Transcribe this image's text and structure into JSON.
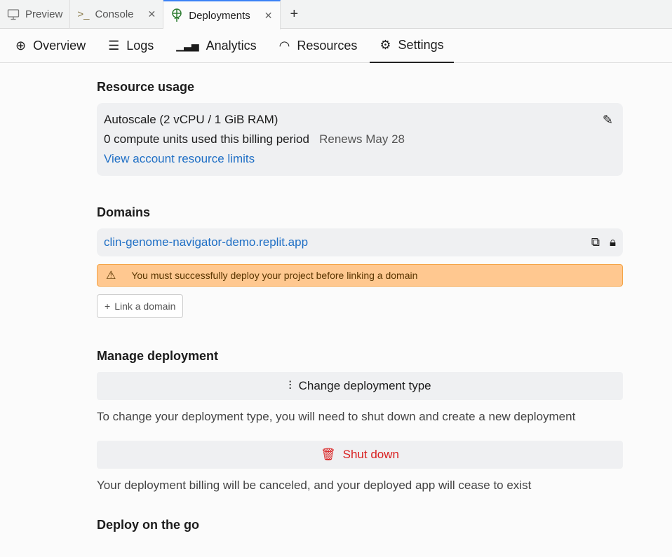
{
  "tabs": [
    {
      "label": "Preview",
      "icon": "monitor-icon"
    },
    {
      "label": "Console",
      "icon": "terminal-icon",
      "closable": true
    },
    {
      "label": "Deployments",
      "icon": "deploy-icon",
      "closable": true,
      "active": true
    }
  ],
  "new_tab": "+",
  "subnav": [
    {
      "label": "Overview"
    },
    {
      "label": "Logs"
    },
    {
      "label": "Analytics"
    },
    {
      "label": "Resources"
    },
    {
      "label": "Settings",
      "active": true
    }
  ],
  "resource": {
    "title": "Resource usage",
    "plan": "Autoscale (2 vCPU / 1 GiB RAM)",
    "usage": "0 compute units used this billing period",
    "renews": "Renews May 28",
    "limits_link": "View account resource limits"
  },
  "domains": {
    "title": "Domains",
    "url": "clin-genome-navigator-demo.replit.app",
    "warning": "You must successfully deploy your project before linking a domain",
    "link_button": "Link a domain"
  },
  "manage": {
    "title": "Manage deployment",
    "change_button": "Change deployment type",
    "change_note": "To change your deployment type, you will need to shut down and create a new deployment",
    "shutdown_button": "Shut down",
    "shutdown_note": "Your deployment billing will be canceled, and your deployed app will cease to exist"
  },
  "next_section": "Deploy on the go",
  "colors": {
    "link": "#1f6fc5",
    "warning_bg": "#ffc890",
    "danger": "#d92020",
    "deploy_green": "#2e7d32"
  }
}
